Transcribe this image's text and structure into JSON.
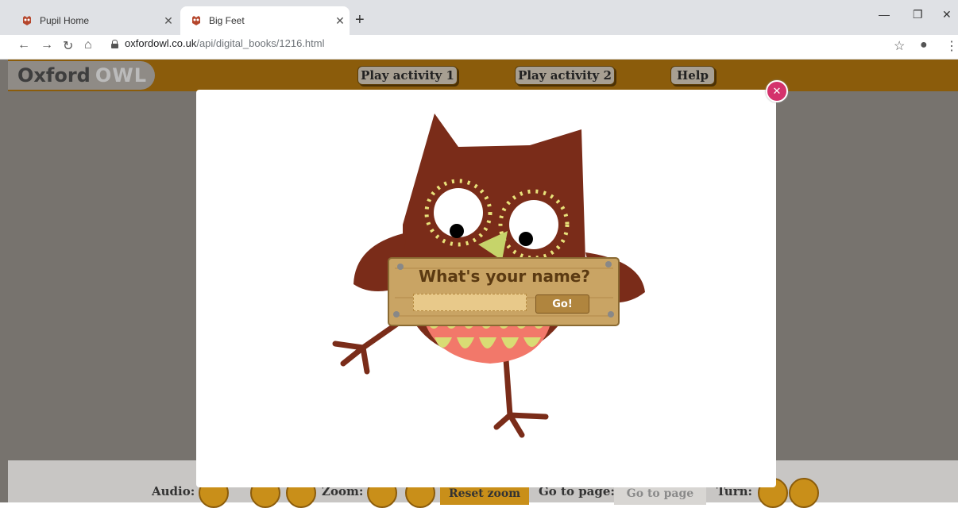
{
  "browser": {
    "tabs": [
      {
        "title": "Pupil Home",
        "active": false
      },
      {
        "title": "Big Feet",
        "active": true
      }
    ],
    "url_domain": "oxfordowl.co.uk",
    "url_path": "/api/digital_books/1216.html"
  },
  "header": {
    "logo_text_1": "Oxford",
    "logo_text_2": "OWL",
    "nav": [
      "Play activity 1",
      "Play activity 2",
      "Help"
    ]
  },
  "modal": {
    "prompt": "What's your name?",
    "input_value": "",
    "go_label": "Go!"
  },
  "footer": {
    "audio_label": "Audio:",
    "zoom_label": "Zoom:",
    "reset_zoom": "Reset zoom",
    "goto_label": "Go to page:",
    "goto_button": "Go to page",
    "turn_label": "Turn:"
  },
  "colors": {
    "header_brown": "#8b5c0b",
    "owl_body": "#7a2c19",
    "close_pink": "#d4326c"
  }
}
